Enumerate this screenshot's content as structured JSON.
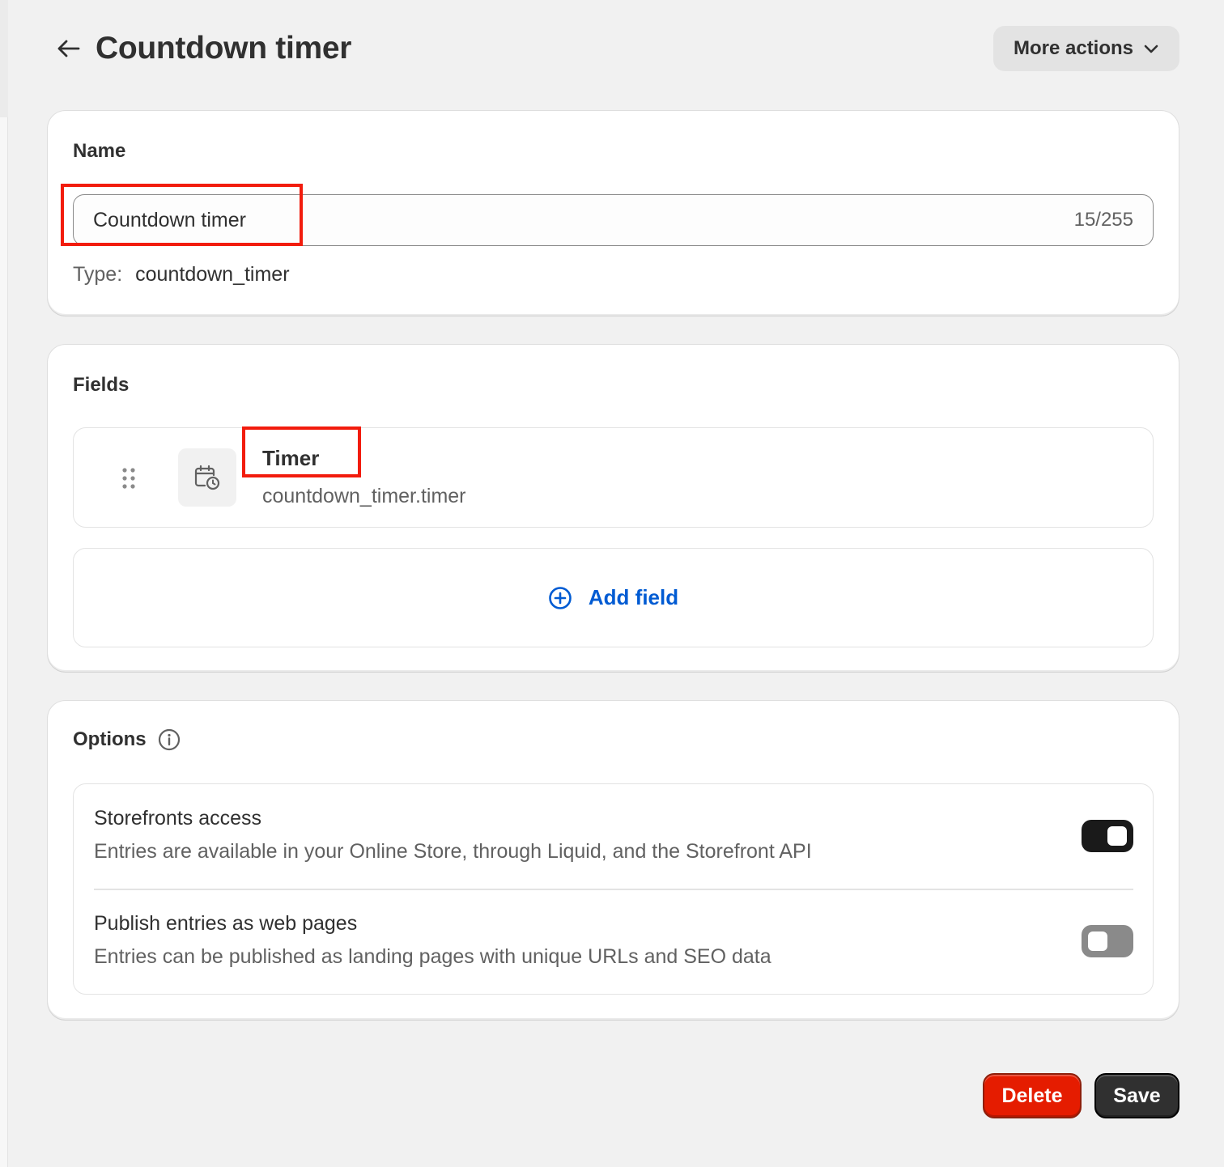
{
  "header": {
    "title": "Countdown timer",
    "more_actions_label": "More actions"
  },
  "name_card": {
    "title": "Name",
    "input_value": "Countdown timer",
    "char_count": "15/255",
    "type_label": "Type:",
    "type_value": "countdown_timer"
  },
  "fields_card": {
    "title": "Fields",
    "items": [
      {
        "name": "Timer",
        "key": "countdown_timer.timer",
        "icon": "calendar-clock-icon"
      }
    ],
    "add_field_label": "Add field"
  },
  "options_card": {
    "title": "Options",
    "items": [
      {
        "title": "Storefronts access",
        "description": "Entries are available in your Online Store, through Liquid, and the Storefront API",
        "enabled": true
      },
      {
        "title": "Publish entries as web pages",
        "description": "Entries can be published as landing pages with unique URLs and SEO data",
        "enabled": false
      }
    ]
  },
  "footer": {
    "delete_label": "Delete",
    "save_label": "Save"
  },
  "colors": {
    "page_bg": "#f1f1f1",
    "link_blue": "#005bd3",
    "delete_red": "#e51c00",
    "save_dark": "#303030",
    "highlight_red": "#f21c0d"
  }
}
